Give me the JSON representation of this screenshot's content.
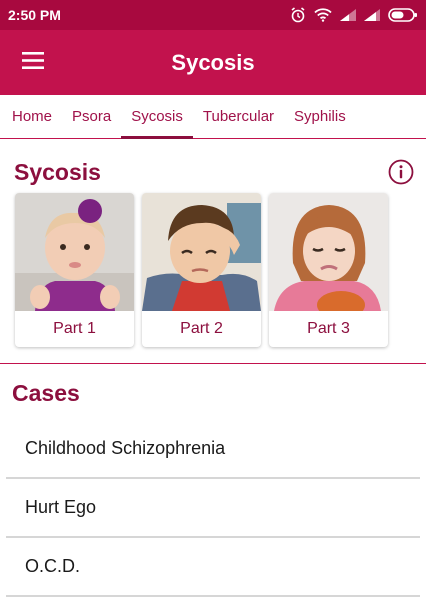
{
  "status_bar": {
    "time": "2:50 PM"
  },
  "app_bar": {
    "title": "Sycosis"
  },
  "tabs": [
    {
      "label": "Home"
    },
    {
      "label": "Psora"
    },
    {
      "label": "Sycosis",
      "active": true
    },
    {
      "label": "Tubercular"
    },
    {
      "label": "Syphilis"
    }
  ],
  "section": {
    "title": "Sycosis"
  },
  "parts": [
    {
      "label": "Part 1"
    },
    {
      "label": "Part 2"
    },
    {
      "label": "Part 3"
    }
  ],
  "cases": {
    "title": "Cases",
    "items": [
      {
        "label": "Childhood Schizophrenia"
      },
      {
        "label": "Hurt Ego"
      },
      {
        "label": "O.C.D."
      }
    ]
  },
  "colors": {
    "status_bar": "#a8093f",
    "app_bar": "#c2124d",
    "accent": "#8c0f3e"
  }
}
